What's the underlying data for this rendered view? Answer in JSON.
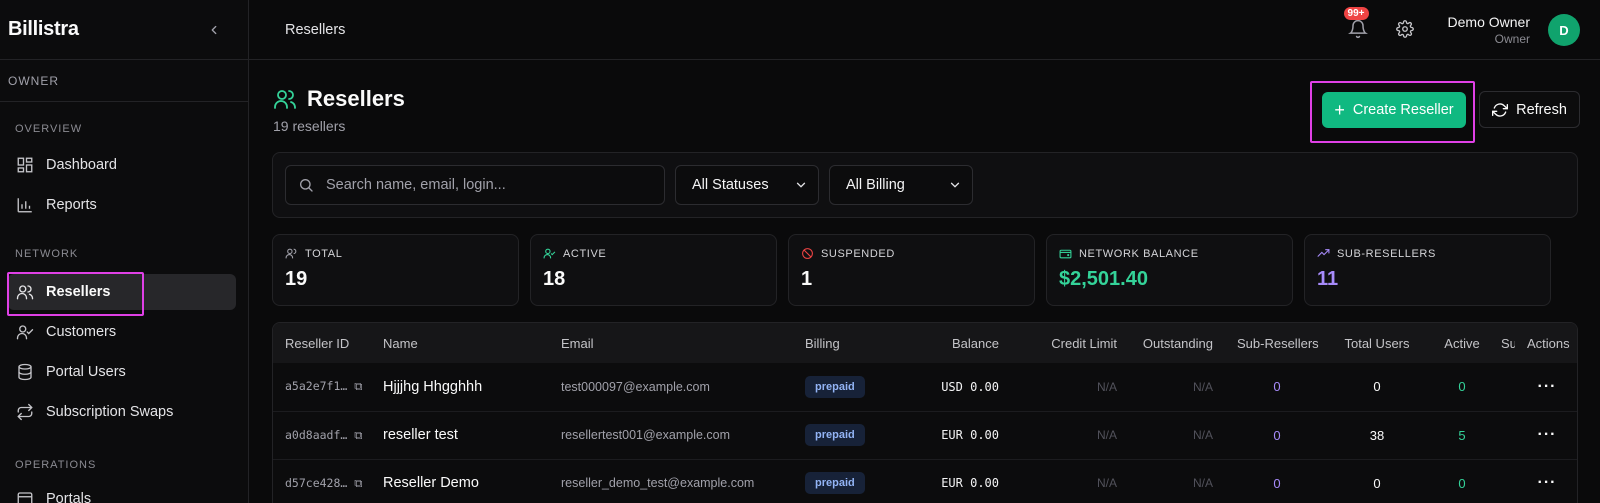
{
  "app": {
    "brand": "Billistra"
  },
  "sidebar": {
    "role": "OWNER",
    "sections": {
      "overview": "OVERVIEW",
      "network": "NETWORK",
      "operations": "OPERATIONS"
    },
    "items": [
      {
        "label": "Dashboard",
        "icon": "dashboard-icon"
      },
      {
        "label": "Reports",
        "icon": "bar-chart-icon"
      },
      {
        "label": "Resellers",
        "icon": "users-icon",
        "active": true
      },
      {
        "label": "Customers",
        "icon": "user-check-icon"
      },
      {
        "label": "Portal Users",
        "icon": "database-icon"
      },
      {
        "label": "Subscription Swaps",
        "icon": "swap-icon"
      },
      {
        "label": "Portals",
        "icon": "portal-icon"
      }
    ]
  },
  "topbar": {
    "breadcrumb": "Resellers",
    "notifications": "99+",
    "user_name": "Demo Owner",
    "user_role": "Owner",
    "avatar_initial": "D"
  },
  "page": {
    "title": "Resellers",
    "subtitle": "19 resellers",
    "create_label": "Create Reseller",
    "refresh_label": "Refresh"
  },
  "filters": {
    "search_placeholder": "Search name, email, login...",
    "status_value": "All Statuses",
    "billing_value": "All Billing"
  },
  "stats": [
    {
      "label": "TOTAL",
      "value": "19",
      "color": "#fafafa"
    },
    {
      "label": "ACTIVE",
      "value": "18",
      "color": "#fafafa"
    },
    {
      "label": "SUSPENDED",
      "value": "1",
      "color": "#fafafa"
    },
    {
      "label": "NETWORK BALANCE",
      "value": "$2,501.40",
      "color": "#34d399"
    },
    {
      "label": "SUB-RESELLERS",
      "value": "11",
      "color": "#a78bfa"
    }
  ],
  "table": {
    "columns": [
      "Reseller ID",
      "Name",
      "Email",
      "Billing",
      "Balance",
      "Credit Limit",
      "Outstanding",
      "Sub-Resellers",
      "Total Users",
      "Active",
      "Su",
      "Actions"
    ],
    "rows": [
      {
        "id": "a5a2e7f1…",
        "name": "Hjjjhg Hhgghhh",
        "email": "test000097@example.com",
        "billing": "prepaid",
        "balance": "USD 0.00",
        "credit": "N/A",
        "outstanding": "N/A",
        "sub": "0",
        "users": "0",
        "active": "0"
      },
      {
        "id": "a0d8aadf…",
        "name": "reseller test",
        "email": "resellertest001@example.com",
        "billing": "prepaid",
        "balance": "EUR 0.00",
        "credit": "N/A",
        "outstanding": "N/A",
        "sub": "0",
        "users": "38",
        "active": "5"
      },
      {
        "id": "d57ce428…",
        "name": "Reseller Demo",
        "email": "reseller_demo_test@example.com",
        "billing": "prepaid",
        "balance": "EUR 0.00",
        "credit": "N/A",
        "outstanding": "N/A",
        "sub": "0",
        "users": "0",
        "active": "0"
      }
    ],
    "actions_glyph": "···"
  }
}
